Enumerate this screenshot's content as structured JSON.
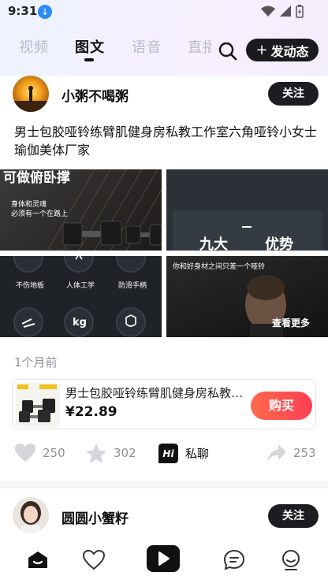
{
  "status_bar": {
    "time": "9:31"
  },
  "tabs": [
    {
      "label": "视频"
    },
    {
      "label": "图文"
    },
    {
      "label": "语音"
    },
    {
      "label": "直播"
    }
  ],
  "header": {
    "post_button_label": "发动态"
  },
  "post1": {
    "username": "小粥不喝粥",
    "follow_label": "关注",
    "content": "男士包胶哑铃练臂肌健身房私教工作室六角哑铃小女士瑜伽美体厂家",
    "images": {
      "img1_title": "可做俯卧撑",
      "img1_sub1": "身体和灵魂",
      "img1_sub2": "必须有一个在路上",
      "img2_left": "九大",
      "img2_right": "优势",
      "img3_labels": [
        "不伤地板",
        "人体工学",
        "防滑手柄"
      ],
      "img3_icon_text": "kg",
      "img4_caption": "你和好身材之间只差一个哑铃",
      "img4_more": "查看更多"
    },
    "time_ago": "1个月前",
    "product": {
      "title": "男士包胶哑铃练臂肌健身房私教工作室六角哑铃",
      "price": "¥22.89",
      "buy_label": "购买"
    },
    "likes": "250",
    "stars": "302",
    "chat_label": "私聊",
    "shares": "253"
  },
  "post2": {
    "username": "圆圆小蟹籽",
    "follow_label": "关注"
  },
  "colors": {
    "accent_dark": "#1b1b1f",
    "buy_gradient_start": "#ff6a4d",
    "buy_gradient_end": "#ff3f55",
    "muted_text": "#8d9099"
  },
  "bottom_nav": [
    {
      "icon": "home-icon"
    },
    {
      "icon": "heart-icon"
    },
    {
      "icon": "play-icon"
    },
    {
      "icon": "message-icon"
    },
    {
      "icon": "profile-icon"
    }
  ]
}
